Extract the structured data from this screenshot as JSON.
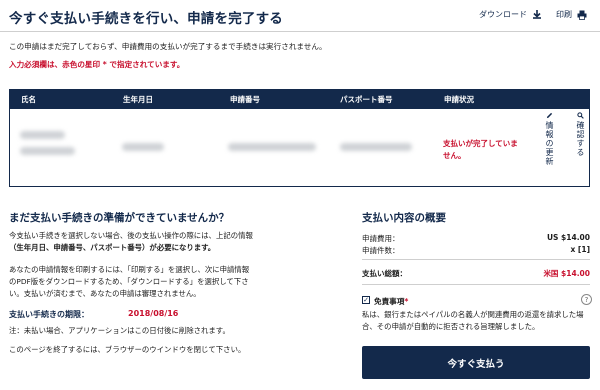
{
  "header": {
    "title": "今すぐ支払い手続きを行い、申請を完了する",
    "download_label": "ダウンロード",
    "print_label": "印刷"
  },
  "intro": {
    "text": "この申請はまだ完了しておらず、申請費用の支払いが完了するまで手続きは実行されません。",
    "required_note": "入力必須欄は、赤色の星印 * で指定されています。"
  },
  "table": {
    "headers": [
      "氏名",
      "生年月日",
      "申請番号",
      "パスポート番号",
      "申請状況"
    ],
    "row": {
      "status": "支払いが完了していません。",
      "update_label": "情報の更新",
      "confirm_label": "確認する"
    }
  },
  "left": {
    "title": "まだ支払い手続きの準備ができていませんか？",
    "para1_line1": "今支払い手続きを選択しない場合、後の支払い操作の際には、上記の情報",
    "para1_line2": "（生年月日、申請番号、パスポート番号）が必要になります。",
    "para2_line1": "あなたの申請情報を印刷するには、「印刷する」を選択し、次に申請情報",
    "para2_line2": "のPDF版をダウンロードするため、「ダウンロードする」を選択して下さ",
    "para2_line3": "い。支払いが済むまで、あなたの申請は審理されません。",
    "deadline_label": "支払い手続きの期限：",
    "deadline_date": "2018/08/16",
    "note": "注：未払い場合、アプリケーションはこの日付後に削除されます。",
    "close_note": "このページを終了するには、ブラウザーのウインドウを閉じて下さい。"
  },
  "summary": {
    "title": "支払い内容の概要",
    "fee_label": "申請費用：",
    "fee_value": "US $14.00",
    "count_label": "申請件数：",
    "count_value": "x [1]",
    "total_label": "支払い総額：",
    "total_value": "米国 $14.00",
    "disclaimer_label": "免責事項",
    "disclaimer_star": "*",
    "disclaimer_checked": true,
    "disclaimer_text": "私は、銀行またはペイパルの名義人が関連費用の返還を請求した場合、その申請が自動的に拒否される旨理解しました。",
    "pay_button": "今すぐ支払う"
  },
  "colors": {
    "navy": "#13294b",
    "red": "#c8102e"
  },
  "icons": {
    "download": "download-icon",
    "print": "print-icon",
    "pencil": "pencil-icon",
    "search": "search-icon",
    "help": "help-icon"
  }
}
